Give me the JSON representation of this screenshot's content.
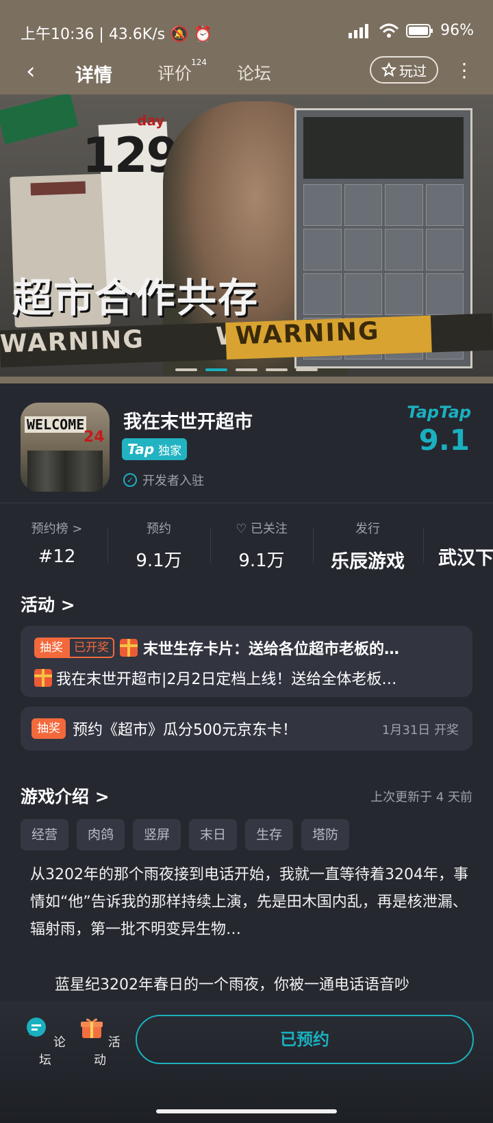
{
  "status_bar": {
    "time": "上午10:36",
    "net_speed": "43.6K/s",
    "battery": "96%"
  },
  "nav": {
    "tabs": [
      {
        "label": "详情",
        "active": true
      },
      {
        "label": "评价",
        "count": "124"
      },
      {
        "label": "论坛"
      }
    ],
    "played_label": "玩过"
  },
  "banner": {
    "title": "超市合作共存",
    "day_label": "day",
    "day_number": "129",
    "warning_text": "WARNING",
    "slide_count": 5,
    "active_slide": 2
  },
  "app": {
    "icon_text": "WELCOME",
    "icon_number": "24",
    "name": "我在末世开超市",
    "tap_label": "Tap",
    "exclusive_label": "独家",
    "developer_label": "开发者入驻",
    "rating_source": "TapTap",
    "rating": "9.1"
  },
  "stats": [
    {
      "key": "预约榜 >",
      "value": "#12"
    },
    {
      "key": "预约",
      "value": "9.1万"
    },
    {
      "key": "已关注",
      "value": "9.1万"
    },
    {
      "key": "发行",
      "value": "乐辰游戏"
    },
    {
      "key": "",
      "value": "武汉下"
    }
  ],
  "activity": {
    "title": "活动 >",
    "card1": {
      "badge": "抽奖",
      "badge_status": "已开奖",
      "line1": "末世生存卡片：送给各位超市老板的…",
      "line2": "我在末世开超市|2月2日定档上线！送给全体老板…"
    },
    "card2": {
      "badge": "抽奖",
      "text": "预约《超市》瓜分500元京东卡！",
      "date": "1月31日 开奖"
    }
  },
  "intro": {
    "title": "游戏介绍 >",
    "updated": "上次更新于 4 天前",
    "tags": [
      "经营",
      "肉鸽",
      "竖屏",
      "末日",
      "生存",
      "塔防"
    ],
    "text": "从3202年的那个雨夜接到电话开始，我就一直等待着3204年，事情如“他”告诉我的那样持续上演，先是田木国内乱，再是核泄漏、辐射雨，第一批不明变异生物…",
    "text2": "蓝星纪3202年春日的一个雨夜，你被一通电话语音吵"
  },
  "bottom_bar": {
    "forum_label": "论坛",
    "activity_label": "活动",
    "reserve_label": "已预约"
  },
  "colors": {
    "accent": "#1ab0bf",
    "orange": "#f3693c",
    "panel_bg": "#262830",
    "header_bg": "#7b6f5f"
  }
}
